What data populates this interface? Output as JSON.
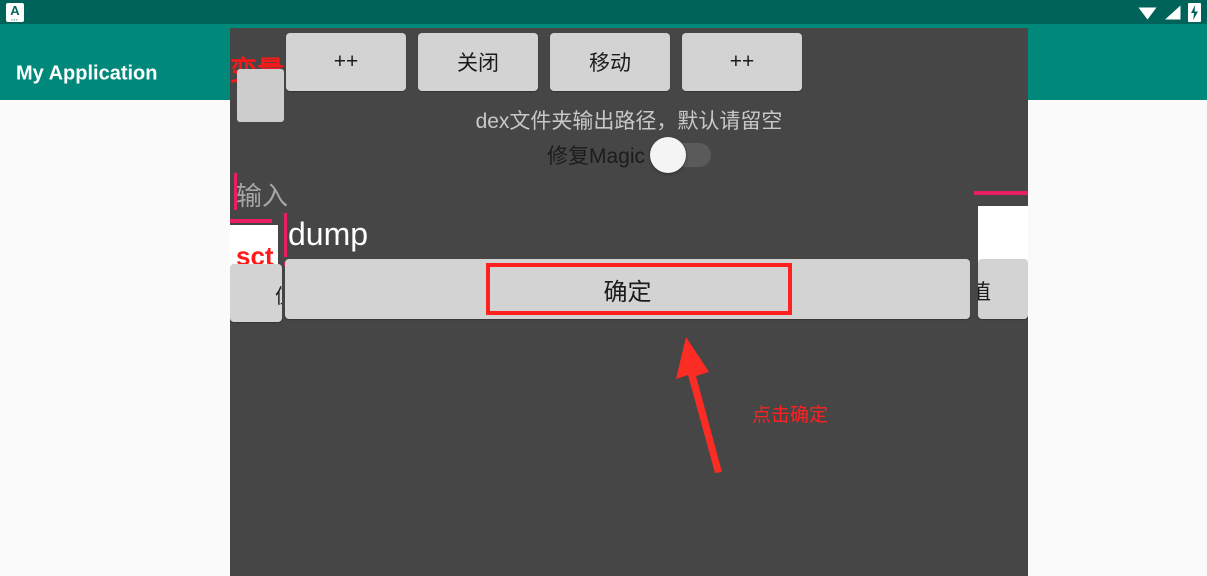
{
  "statusbar": {
    "app_icon_letter": "A",
    "app_icon_dots": "▪▪▪",
    "icons": [
      "wifi-icon",
      "signal-icon",
      "battery-charging-icon"
    ],
    "background_color": "#00635a"
  },
  "appbar": {
    "title": "My Application",
    "background_color": "#00897b",
    "title_color": "#ffffff"
  },
  "overlay": {
    "background_color": "#464646",
    "var_label": "变量",
    "top_buttons": [
      {
        "label": "++"
      },
      {
        "label": "关闭"
      },
      {
        "label": "移动"
      },
      {
        "label": "++"
      }
    ],
    "dex_hint": "dex文件夹输出路径，默认请留空",
    "magic": {
      "label": "修复Magic",
      "toggle_state": "off",
      "knob_color": "#f4f4f4",
      "track_color": "#5a5a5a"
    },
    "left_input": {
      "placeholder": "输入",
      "underline_color": "#e91e63"
    },
    "sct_card": {
      "text": "sct",
      "text_color": "#ff1a1a",
      "background_color": "#ffffff"
    },
    "dump_input": {
      "value": "dump",
      "underline_color": "#e91e63",
      "text_color": "#ffffff"
    },
    "confirm_button": {
      "label": "确定"
    },
    "left_clipped_button": {
      "glyph": "值"
    },
    "right_clipped_button": {
      "glyph": "值"
    }
  },
  "annotations": {
    "highlight_color": "#ff2020",
    "arrow": "up-left-arrow",
    "text": "点击确定"
  }
}
